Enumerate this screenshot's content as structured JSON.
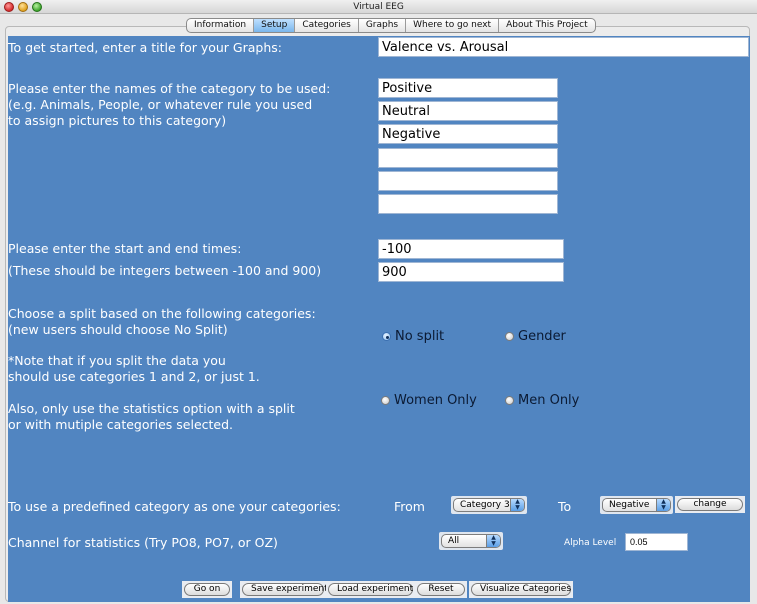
{
  "window": {
    "title": "Virtual EEG"
  },
  "tabs": [
    {
      "label": "Information",
      "active": false
    },
    {
      "label": "Setup",
      "active": true
    },
    {
      "label": "Categories",
      "active": false
    },
    {
      "label": "Graphs",
      "active": false
    },
    {
      "label": "Where to go next",
      "active": false
    },
    {
      "label": "About This Project",
      "active": false
    }
  ],
  "setup": {
    "title_prompt": "To get started, enter a title for your Graphs:",
    "title_value": "Valence vs. Arousal",
    "category_prompt": [
      "Please enter the names of the category to be used:",
      "(e.g. Animals, People, or whatever rule you used",
      "to assign pictures to this category)"
    ],
    "categories": [
      "Positive",
      "Neutral",
      "Negative",
      "",
      "",
      ""
    ],
    "times_prompt": "Please enter the start and end times:",
    "times_hint": "(These should be integers between -100 and 900)",
    "start_time": "-100",
    "end_time": "900",
    "split_prompt": [
      "Choose a split based on the following categories:",
      "(new users should choose No Split)"
    ],
    "split_note": [
      "*Note that if you split the data you",
      "should use categories 1 and 2, or just 1."
    ],
    "stats_note": [
      "Also, only use the statistics option with a split",
      "or with mutiple categories selected."
    ],
    "split_options": [
      {
        "label": "No split",
        "selected": true
      },
      {
        "label": "Gender",
        "selected": false
      },
      {
        "label": "Women Only",
        "selected": false
      },
      {
        "label": "Men Only",
        "selected": false
      }
    ],
    "predefined_prompt": "To use a predefined category as one your categories:",
    "from_label": "From",
    "from_value": "Category 3",
    "to_label": "To",
    "to_value": "Negative",
    "change_label": "change",
    "channel_prompt": "Channel for statistics (Try PO8, PO7, or OZ)",
    "channel_value": "All",
    "alpha_label": "Alpha Level",
    "alpha_value": "0.05"
  },
  "buttons": {
    "go_on": "Go on",
    "save": "Save experiment",
    "load": "Load experiment",
    "reset": "Reset",
    "visualize": "Visualize Categories"
  },
  "icons": {
    "close": "close-icon",
    "minimize": "minimize-icon",
    "maximize": "maximize-icon",
    "select_arrows": "updown-arrows-icon"
  }
}
